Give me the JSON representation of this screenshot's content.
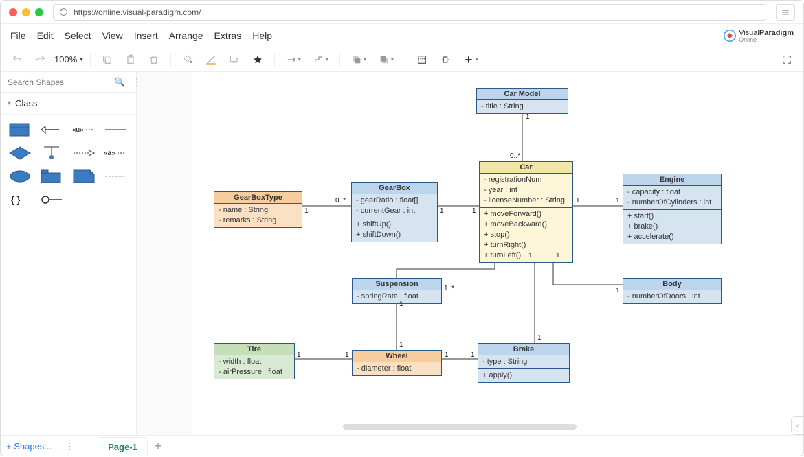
{
  "browser": {
    "url": "https://online.visual-paradigm.com/"
  },
  "menu": {
    "file": "File",
    "edit": "Edit",
    "select": "Select",
    "view": "View",
    "insert": "Insert",
    "arrange": "Arrange",
    "extras": "Extras",
    "help": "Help"
  },
  "brand": {
    "line1a": "Visual",
    "line1b": "Paradigm",
    "line2": "Online"
  },
  "zoom": "100%",
  "search": {
    "placeholder": "Search Shapes"
  },
  "category": "Class",
  "shapes_btn": "+  Shapes...",
  "page_tab": "Page-1",
  "classes": {
    "carmodel": {
      "name": "Car Model",
      "attrs": [
        "- title : String"
      ]
    },
    "car": {
      "name": "Car",
      "attrs": [
        "- registrationNum",
        "- year : int",
        "- licenseNumber : String"
      ],
      "ops": [
        "+ moveForward()",
        "+ moveBackward()",
        "+ stop()",
        "+ turnRight()",
        "+ turnLeft()"
      ]
    },
    "engine": {
      "name": "Engine",
      "attrs": [
        "- capacity : float",
        "- numberOfCylinders : int"
      ],
      "ops": [
        "+ start()",
        "+ brake()",
        "+ accelerate()"
      ]
    },
    "gearbox": {
      "name": "GearBox",
      "attrs": [
        "- gearRatio : float[]",
        "- currentGear : int"
      ],
      "ops": [
        "+ shiftUp()",
        "+ shiftDown()"
      ]
    },
    "gearboxtype": {
      "name": "GearBoxType",
      "attrs": [
        "- name : String",
        "- remarks : String"
      ]
    },
    "suspension": {
      "name": "Suspension",
      "attrs": [
        "- springRate : float"
      ]
    },
    "body": {
      "name": "Body",
      "attrs": [
        "- numberOfDoors : int"
      ]
    },
    "brake": {
      "name": "Brake",
      "attrs": [
        "- type : String"
      ],
      "ops": [
        "+ apply()"
      ]
    },
    "wheel": {
      "name": "Wheel",
      "attrs": [
        "- diameter : float"
      ]
    },
    "tire": {
      "name": "Tire",
      "attrs": [
        "- width : float",
        "- airPressure : float"
      ]
    }
  },
  "mult": {
    "carmodel_car_top": "1",
    "carmodel_car_bot": "0..*",
    "car_gearbox_l": "1",
    "car_gearbox_r": "1",
    "car_engine_l": "1",
    "car_engine_r": "1",
    "gearbox_type_l": "0..*",
    "gearbox_type_r": "1",
    "car_susp_top": "1",
    "car_susp_bot": "1..*",
    "car_body_top": "1",
    "car_body_bot": "1",
    "car_brake_top": "1",
    "car_brake_bot": "1",
    "susp_wheel_top": "1",
    "susp_wheel_bot": "1",
    "wheel_tire_l": "1",
    "wheel_tire_r": "1"
  }
}
